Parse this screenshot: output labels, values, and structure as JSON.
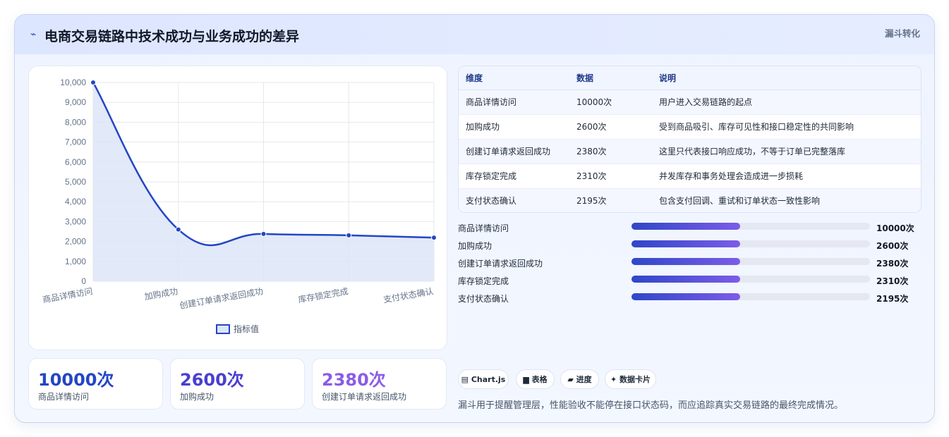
{
  "header": {
    "title": "电商交易链路中技术成功与业务成功的差异",
    "tag": "漏斗转化",
    "title_icon": "chart-line-icon"
  },
  "chart_data": {
    "type": "line",
    "categories": [
      "商品详情访问",
      "加购成功",
      "创建订单请求返回成功",
      "库存锁定完成",
      "支付状态确认"
    ],
    "series": [
      {
        "name": "指标值",
        "values": [
          10000,
          2600,
          2380,
          2310,
          2195
        ]
      }
    ],
    "ylim": [
      0,
      10000
    ],
    "yticks": [
      "0",
      "1,000",
      "2,000",
      "3,000",
      "4,000",
      "5,000",
      "6,000",
      "7,000",
      "8,000",
      "9,000",
      "10,000"
    ],
    "grid": true,
    "legend": "bottom",
    "line_color": "#2446c4",
    "fill_color": "#dde5f7"
  },
  "kpis": [
    {
      "value": "10000次",
      "label": "商品详情访问",
      "color": "#2446c4"
    },
    {
      "value": "2600次",
      "label": "加购成功",
      "color": "#4a3fd0"
    },
    {
      "value": "2380次",
      "label": "创建订单请求返回成功",
      "color": "#8b5ce6"
    }
  ],
  "table": {
    "headers": [
      "维度",
      "数据",
      "说明"
    ],
    "rows": [
      [
        "商品详情访问",
        "10000次",
        "用户进入交易链路的起点"
      ],
      [
        "加购成功",
        "2600次",
        "受到商品吸引、库存可见性和接口稳定性的共同影响"
      ],
      [
        "创建订单请求返回成功",
        "2380次",
        "这里只代表接口响应成功，不等于订单已完整落库"
      ],
      [
        "库存锁定完成",
        "2310次",
        "并发库存和事务处理会造成进一步损耗"
      ],
      [
        "支付状态确认",
        "2195次",
        "包含支付回调、重试和订单状态一致性影响"
      ]
    ]
  },
  "progress": [
    {
      "label": "商品详情访问",
      "value": "10000次",
      "fill": 0.455
    },
    {
      "label": "加购成功",
      "value": "2600次",
      "fill": 0.455
    },
    {
      "label": "创建订单请求返回成功",
      "value": "2380次",
      "fill": 0.455
    },
    {
      "label": "库存锁定完成",
      "value": "2310次",
      "fill": 0.455
    },
    {
      "label": "支付状态确认",
      "value": "2195次",
      "fill": 0.455
    }
  ],
  "pills": [
    {
      "icon": "chart-icon",
      "label": "▤ Chart.js"
    },
    {
      "icon": "table-icon",
      "label": "▆ 表格"
    },
    {
      "icon": "progress-icon",
      "label": "▰ 进度"
    },
    {
      "icon": "sparkle-icon",
      "label": "✦ 数据卡片"
    }
  ],
  "note": "漏斗用于提醒管理层，性能验收不能停在接口状态码，而应追踪真实交易链路的最终完成情况。"
}
